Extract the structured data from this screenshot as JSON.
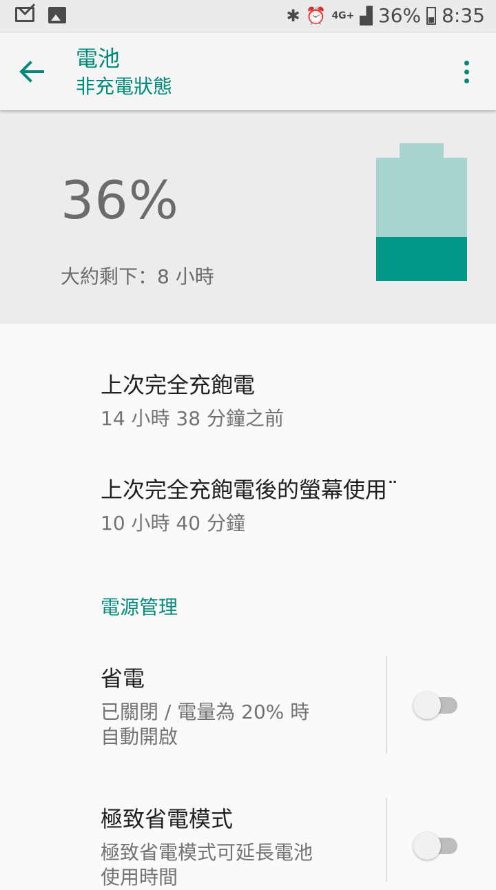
{
  "status_bar": {
    "battery_text": "36%",
    "time": "8:35",
    "network": "4G+",
    "icons": [
      "gmail-icon",
      "image-icon",
      "bluetooth-icon",
      "alarm-icon",
      "4g-icon",
      "signal-icon",
      "battery-icon"
    ]
  },
  "app_bar": {
    "title": "電池",
    "subtitle": "非充電狀態"
  },
  "battery": {
    "percent_text": "36%",
    "level": 0.36,
    "remaining": "大約剩下：8 小時",
    "colors": {
      "fill": "#009688",
      "empty": "#a8d4cf"
    }
  },
  "items": [
    {
      "title": "上次完全充飽電",
      "summary": "14 小時 38 分鐘之前"
    },
    {
      "title": "上次完全充飽電後的螢幕使用¨",
      "summary": "10 小時 40 分鐘"
    }
  ],
  "section": {
    "title": "電源管理"
  },
  "toggles": [
    {
      "title": "省電",
      "summary_line1": "已關閉 / 電量為 20% 時",
      "summary_line2": "自動開啟",
      "on": false
    },
    {
      "title": "極致省電模式",
      "summary_line1": "極致省電模式可延長電池",
      "summary_line2": "使用時間",
      "on": false
    }
  ],
  "accent_color": "#00897b"
}
